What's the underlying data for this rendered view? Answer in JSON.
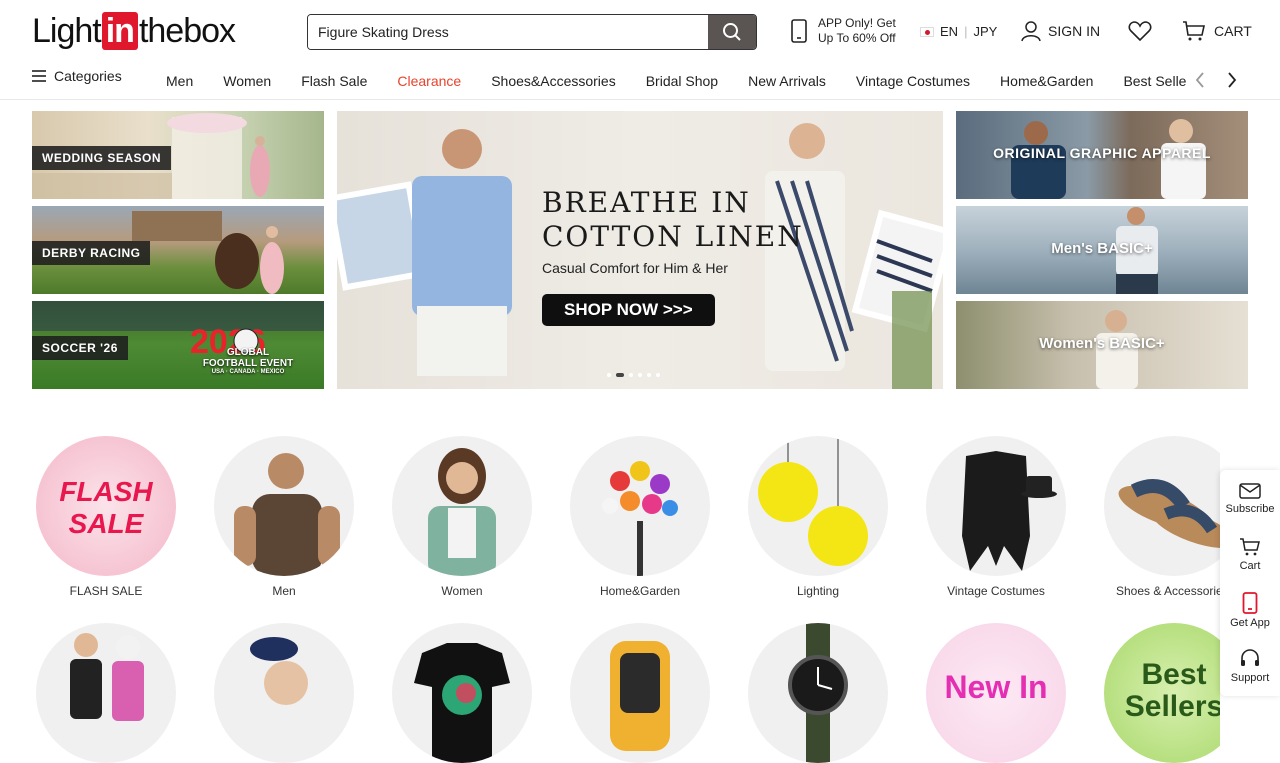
{
  "header": {
    "logo": {
      "light": "Light",
      "in": "in",
      "thebox": "thebox"
    },
    "search_value": "Figure Skating Dress",
    "app_promo_line1": "APP Only! Get",
    "app_promo_line2": "Up To 60% Off",
    "language": "EN",
    "currency": "JPY",
    "signin": "SIGN IN",
    "cart": "CART"
  },
  "nav": {
    "categories": "Categories",
    "items": [
      "Men",
      "Women",
      "Flash Sale",
      "Clearance",
      "Shoes&Accessories",
      "Bridal Shop",
      "New Arrivals",
      "Vintage Costumes",
      "Home&Garden",
      "Best Sellers"
    ]
  },
  "left_tiles": [
    "WEDDING SEASON",
    "DERBY RACING",
    "SOCCER '26"
  ],
  "soccer_badge": {
    "title": "GLOBAL",
    "line": "FOOTBALL EVENT",
    "sub": "USA · CANADA · MEXICO",
    "year": "2026"
  },
  "hero": {
    "title_line1": "BREATHE IN",
    "title_line2": "COTTON LINEN",
    "subtitle": "Casual Comfort for Him & Her",
    "cta": "SHOP NOW >>>"
  },
  "right_tiles": [
    "ORIGINAL GRAPHIC APPAREL",
    "Men's BASIC+",
    "Women's BASIC+"
  ],
  "categories": [
    {
      "label": "FLASH SALE",
      "art": "FLASH SALE"
    },
    {
      "label": "Men"
    },
    {
      "label": "Women"
    },
    {
      "label": "Home&Garden"
    },
    {
      "label": "Lighting"
    },
    {
      "label": "Vintage Costumes"
    },
    {
      "label": "Shoes & Accessories"
    }
  ],
  "row2_art": {
    "new_in": "New In",
    "best_sellers": "Best Sellers"
  },
  "side_bar": [
    "Subscribe",
    "Cart",
    "Get App",
    "Support"
  ],
  "colors": {
    "brand_red": "#e0182d",
    "clearance": "#e8432b",
    "search_btn": "#5a5452"
  }
}
